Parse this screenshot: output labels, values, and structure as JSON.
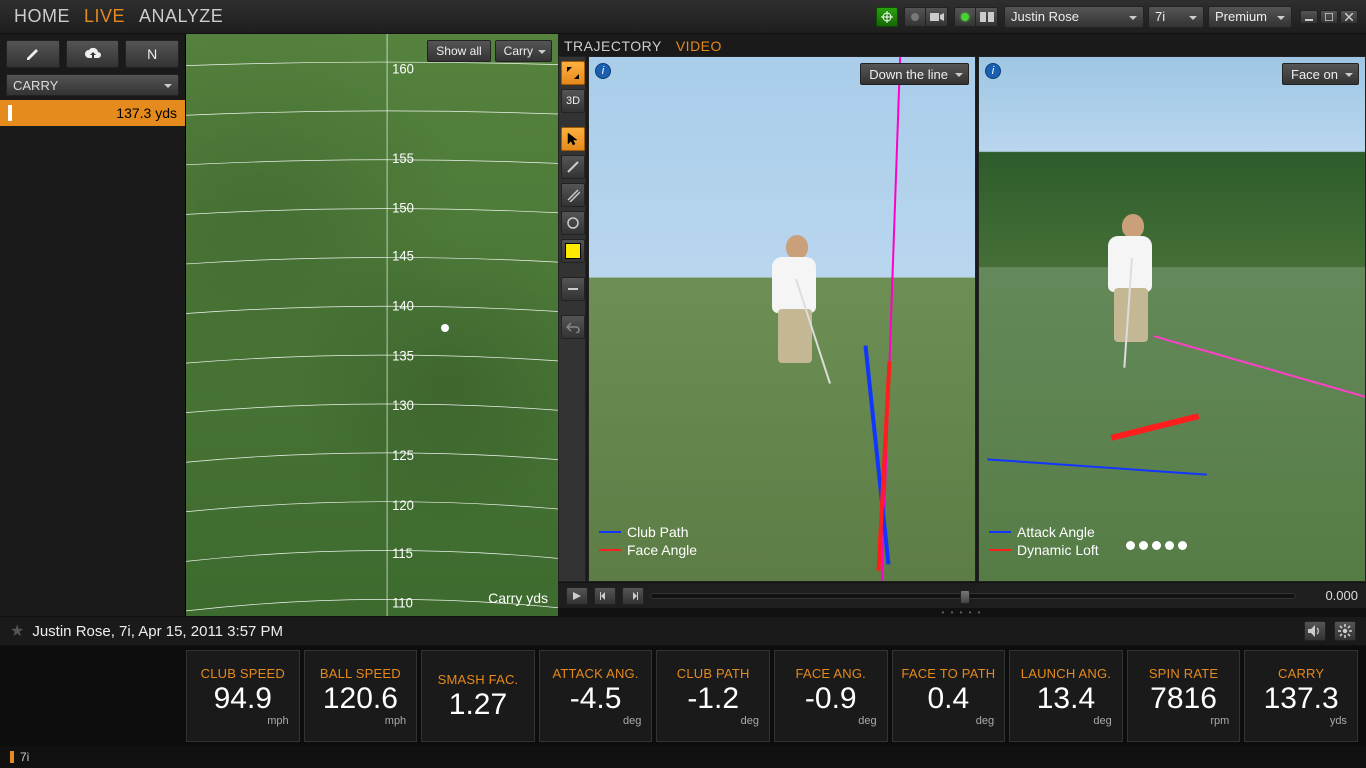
{
  "nav": {
    "home": "HOME",
    "live": "LIVE",
    "analyze": "ANALYZE"
  },
  "top": {
    "player_select": "Justin Rose",
    "club_select": "7i",
    "tier_select": "Premium"
  },
  "sidebar": {
    "metric_select": "CARRY",
    "letter_button": "N",
    "shot": {
      "value": "137.3 yds"
    }
  },
  "field": {
    "show_all_btn": "Show all",
    "mode_select": "Carry",
    "axis_label": "Carry  yds",
    "ticks": [
      "110",
      "115",
      "120",
      "125",
      "130",
      "135",
      "140",
      "145",
      "150",
      "155",
      "160"
    ]
  },
  "videopanel": {
    "tab_trajectory": "TRAJECTORY",
    "tab_video": "VIDEO",
    "tool_3d": "3D",
    "left": {
      "camera_select": "Down the line",
      "legend": [
        {
          "color": "#1336ff",
          "label": "Club Path"
        },
        {
          "color": "#ff1d1d",
          "label": "Face Angle"
        }
      ]
    },
    "right": {
      "camera_select": "Face on",
      "legend": [
        {
          "color": "#1336ff",
          "label": "Attack Angle"
        },
        {
          "color": "#ff1d1d",
          "label": "Dynamic Loft"
        }
      ]
    },
    "playback_time": "0.000"
  },
  "infoline": {
    "text": "Justin Rose, 7i, Apr 15, 2011 3:57 PM"
  },
  "metrics": [
    {
      "label": "CLUB SPEED",
      "value": "94.9",
      "unit": "mph"
    },
    {
      "label": "BALL SPEED",
      "value": "120.6",
      "unit": "mph"
    },
    {
      "label": "SMASH FAC.",
      "value": "1.27",
      "unit": ""
    },
    {
      "label": "ATTACK ANG.",
      "value": "-4.5",
      "unit": "deg"
    },
    {
      "label": "CLUB PATH",
      "value": "-1.2",
      "unit": "deg"
    },
    {
      "label": "FACE ANG.",
      "value": "-0.9",
      "unit": "deg"
    },
    {
      "label": "FACE TO PATH",
      "value": "0.4",
      "unit": "deg"
    },
    {
      "label": "LAUNCH ANG.",
      "value": "13.4",
      "unit": "deg"
    },
    {
      "label": "SPIN RATE",
      "value": "7816",
      "unit": "rpm"
    },
    {
      "label": "CARRY",
      "value": "137.3",
      "unit": "yds"
    }
  ],
  "status": {
    "club": "7i"
  },
  "colors": {
    "accent": "#e58a1c"
  }
}
